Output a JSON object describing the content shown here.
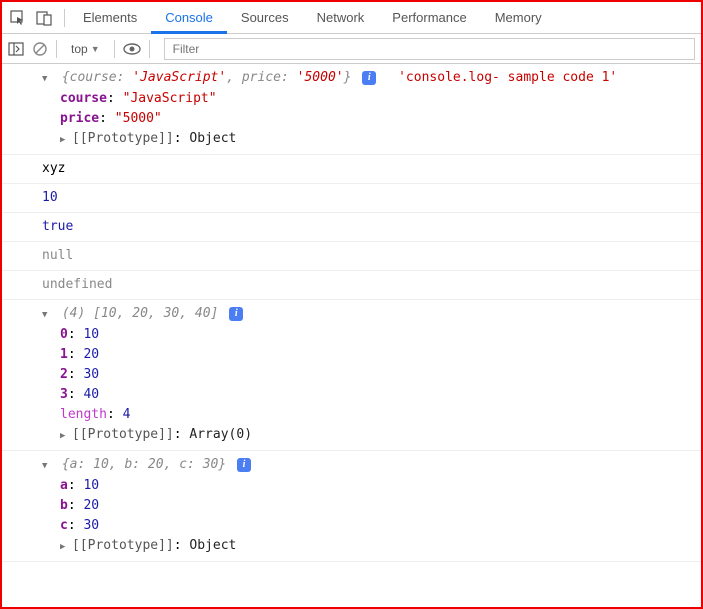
{
  "tabs": {
    "elements": "Elements",
    "console": "Console",
    "sources": "Sources",
    "network": "Network",
    "performance": "Performance",
    "memory": "Memory"
  },
  "toolbar": {
    "context": "top",
    "filter_placeholder": "Filter"
  },
  "out": {
    "obj1_summary_open": "{course: ",
    "obj1_summary_v1": "'JavaScript'",
    "obj1_summary_mid": ", price: ",
    "obj1_summary_v2": "'5000'",
    "obj1_summary_close": "}",
    "obj1_side_msg": "'console.log- sample code 1'",
    "obj1_k1": "course",
    "obj1_v1": "\"JavaScript\"",
    "obj1_k2": "price",
    "obj1_v2": "\"5000\"",
    "proto_label": "[[Prototype]]",
    "proto_obj": "Object",
    "proto_arr": "Array(0)",
    "xyz": "xyz",
    "ten": "10",
    "true": "true",
    "null": "null",
    "undefined": "undefined",
    "arr_len": "(4) ",
    "arr_summary": "[10, 20, 30, 40]",
    "arr_i0": "0",
    "arr_v0": "10",
    "arr_i1": "1",
    "arr_v1": "20",
    "arr_i2": "2",
    "arr_v2": "30",
    "arr_i3": "3",
    "arr_v3": "40",
    "length_key": "length",
    "length_val": "4",
    "obj3_summary": "{a: 10, b: 20, c: 30}",
    "obj3_k1": "a",
    "obj3_v1": "10",
    "obj3_k2": "b",
    "obj3_v2": "20",
    "obj3_k3": "c",
    "obj3_v3": "30"
  },
  "chart_data": {
    "type": "table",
    "title": "Chrome DevTools console output",
    "entries": [
      {
        "type": "object",
        "value": {
          "course": "JavaScript",
          "price": "5000"
        },
        "label": "console.log- sample code 1",
        "prototype": "Object"
      },
      {
        "type": "string",
        "value": "xyz"
      },
      {
        "type": "number",
        "value": 10
      },
      {
        "type": "boolean",
        "value": true
      },
      {
        "type": "null",
        "value": null
      },
      {
        "type": "undefined"
      },
      {
        "type": "array",
        "value": [
          10,
          20,
          30,
          40
        ],
        "length": 4,
        "prototype": "Array(0)"
      },
      {
        "type": "object",
        "value": {
          "a": 10,
          "b": 20,
          "c": 30
        },
        "prototype": "Object"
      }
    ]
  }
}
